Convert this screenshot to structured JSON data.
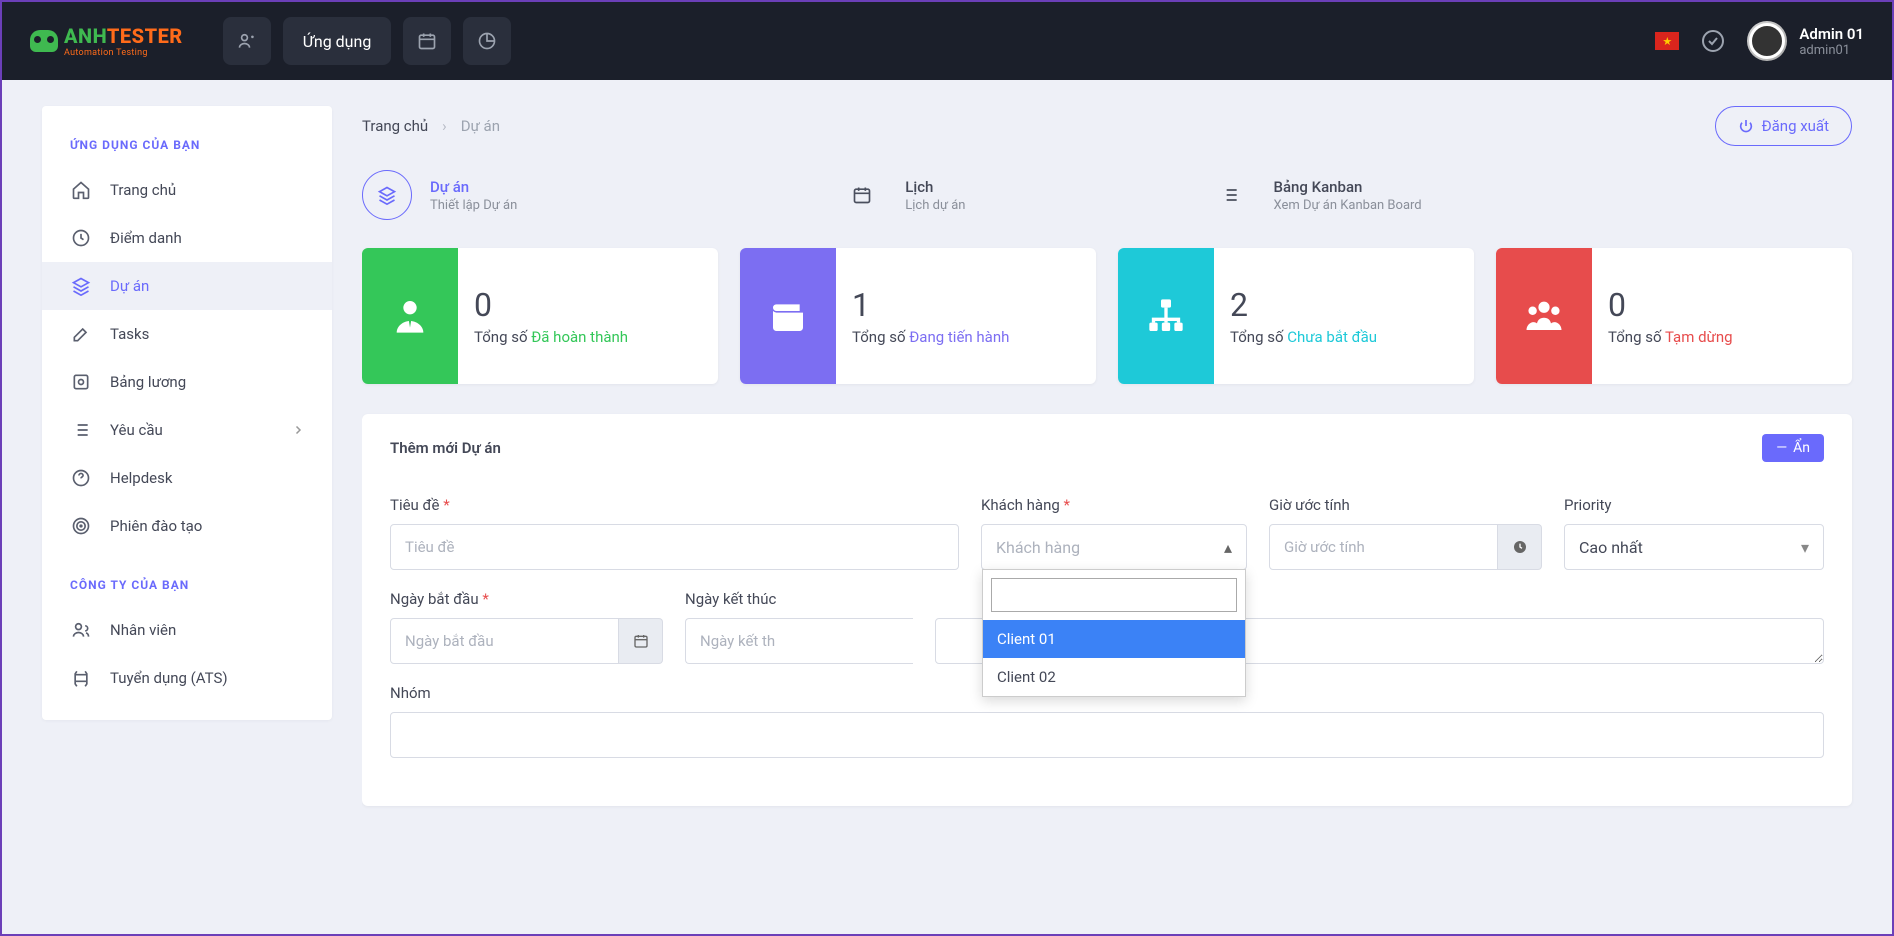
{
  "header": {
    "logo_main_a": "ANH",
    "logo_main_b": "TESTER",
    "logo_sub": "Automation Testing",
    "app_btn": "Ứng dụng",
    "user_name": "Admin 01",
    "user_handle": "admin01"
  },
  "sidebar": {
    "section1": "ỨNG DỤNG CỦA BẠN",
    "section2": "CÔNG TY CỦA BẠN",
    "items": [
      {
        "label": "Trang chủ"
      },
      {
        "label": "Điểm danh"
      },
      {
        "label": "Dự án"
      },
      {
        "label": "Tasks"
      },
      {
        "label": "Bảng lương"
      },
      {
        "label": "Yêu cầu"
      },
      {
        "label": "Helpdesk"
      },
      {
        "label": "Phiên đào tạo"
      }
    ],
    "items2": [
      {
        "label": "Nhân viên"
      },
      {
        "label": "Tuyển dụng (ATS)"
      }
    ]
  },
  "breadcrumb": {
    "home": "Trang chủ",
    "current": "Dự án"
  },
  "logout_btn": "Đăng xuất",
  "tabs": [
    {
      "title": "Dự án",
      "sub": "Thiết lập Dự án"
    },
    {
      "title": "Lịch",
      "sub": "Lịch dự án"
    },
    {
      "title": "Bảng Kanban",
      "sub": "Xem Dự án Kanban Board"
    }
  ],
  "stats": [
    {
      "num": "0",
      "prefix": "Tổng số ",
      "status": "Đã hoàn thành"
    },
    {
      "num": "1",
      "prefix": "Tổng số ",
      "status": "Đang tiến hành"
    },
    {
      "num": "2",
      "prefix": "Tổng số ",
      "status": "Chưa bắt đầu"
    },
    {
      "num": "0",
      "prefix": "Tổng số ",
      "status": "Tạm dừng"
    }
  ],
  "form": {
    "title": "Thêm mới Dự án",
    "hide_btn": "Ẩn",
    "fields": {
      "title_label": "Tiêu đề",
      "title_placeholder": "Tiêu đề",
      "client_label": "Khách hàng",
      "client_placeholder": "Khách hàng",
      "hours_label": "Giờ ước tính",
      "hours_placeholder": "Giờ ước tính",
      "priority_label": "Priority",
      "priority_value": "Cao nhất",
      "start_label": "Ngày bắt đầu",
      "start_placeholder": "Ngày bắt đầu",
      "end_label": "Ngày kết thúc",
      "end_placeholder": "Ngày kết th",
      "group_label": "Nhóm"
    },
    "client_options": [
      "Client 01",
      "Client 02"
    ]
  }
}
